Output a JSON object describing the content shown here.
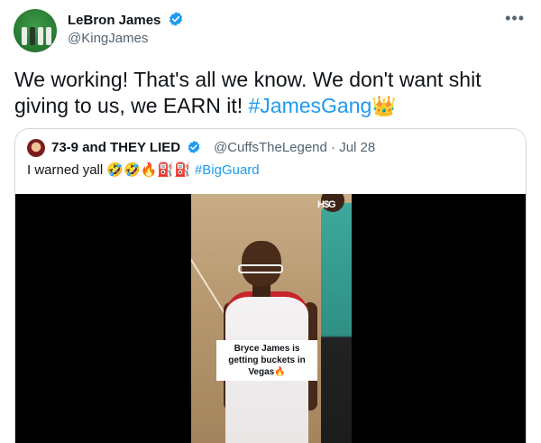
{
  "author": {
    "name": "LeBron James",
    "handle": "@KingJames",
    "verified": true
  },
  "more_icon": "ellipsis-icon",
  "tweet": {
    "text_before_tag": "We working! That's all we know. We don't want shit giving to us, we EARN it! ",
    "hashtag": "#JamesGang",
    "emoji": "👑"
  },
  "quoted": {
    "name": "73-9 and THEY LIED",
    "handle_time": "@CuffsTheLegend · Jul 28",
    "text_before_tag": "I warned yall 🤣🤣🔥⛽⛽ ",
    "hashtag": "#BigGuard",
    "media": {
      "caption": "Bryce James is getting buckets in Vegas🔥",
      "watermark": "H$G"
    }
  },
  "colors": {
    "link": "#1d9bf0",
    "secondary_text": "#536471",
    "verified_badge": "#1d9bf0",
    "border": "#cfd9de"
  }
}
